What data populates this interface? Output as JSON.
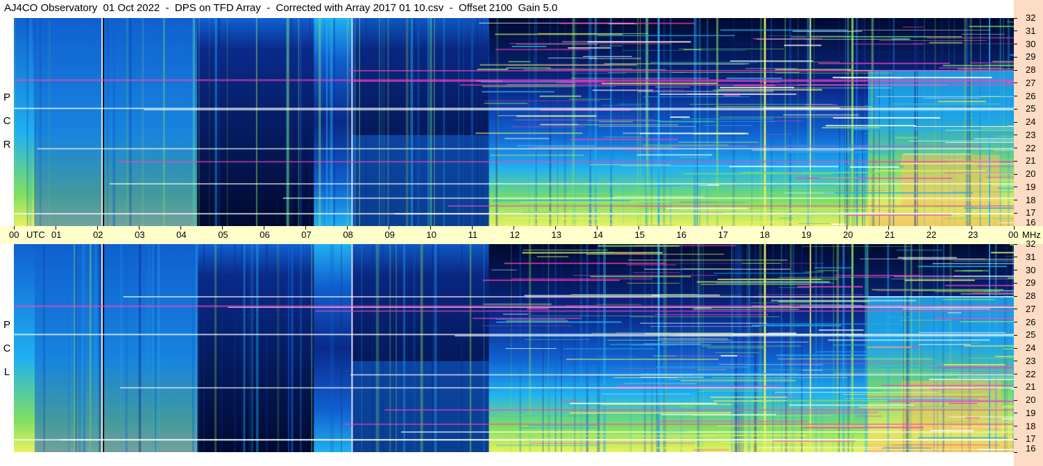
{
  "title": "AJ4CO Observatory  01 Oct 2022  -  DPS on TFD Array  -  Corrected with Array 2017 01 10.csv  -  Offset 2100  Gain 5.0",
  "polarizations": {
    "top": [
      "R",
      "C",
      "P"
    ],
    "bottom": [
      "L",
      "C",
      "P"
    ]
  },
  "time_axis": {
    "utc_label": "UTC",
    "unit_label": "MHz",
    "ticks": [
      "00",
      "01",
      "02",
      "03",
      "04",
      "05",
      "06",
      "07",
      "08",
      "09",
      "10",
      "11",
      "12",
      "13",
      "14",
      "15",
      "16",
      "17",
      "18",
      "19",
      "20",
      "21",
      "22",
      "23",
      "00"
    ]
  },
  "freq_axis": {
    "ticks": [
      "32",
      "31",
      "30",
      "29",
      "28",
      "27",
      "26",
      "25",
      "24",
      "23",
      "22",
      "21",
      "20",
      "19",
      "18",
      "17",
      "16"
    ]
  },
  "colors": {
    "background": "#ffffff",
    "axis_time_bg": "#ffffcc",
    "axis_freq_bg": "#fcdcc4",
    "dark": "#000a30",
    "deep_blue": "#0a2a8a",
    "blue": "#1060d0",
    "cyan": "#20b0f0",
    "green": "#80e060",
    "yellow": "#e8f060",
    "orange": "#f8c060",
    "magenta": "#ff40c0"
  },
  "chart_data": {
    "type": "heatmap",
    "title": "AJ4CO Observatory  01 Oct 2022  -  DPS on TFD Array  -  Corrected with Array 2017 01 10.csv  -  Offset 2100  Gain 5.0",
    "x_unit": "UTC hour",
    "y_unit": "MHz",
    "xlim": [
      0,
      24
    ],
    "ylim": [
      16,
      32
    ],
    "panels": [
      "RCP",
      "LCP"
    ]
  }
}
